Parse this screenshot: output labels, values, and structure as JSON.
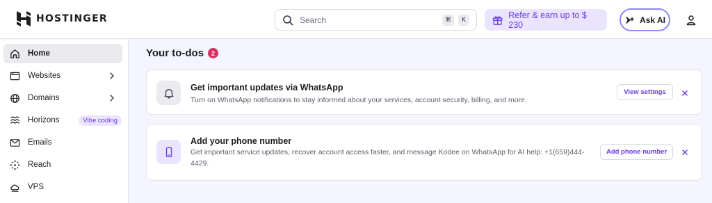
{
  "header": {
    "brand": "HOSTINGER",
    "search": {
      "placeholder": "Search",
      "shortcut_keys": [
        "⌘",
        "K"
      ]
    },
    "refer_label": "Refer & earn up to $ 230",
    "ask_ai_label": "Ask AI",
    "user_icon": "user-icon"
  },
  "sidebar": {
    "items": [
      {
        "label": "Home",
        "icon": "home-icon",
        "active": true
      },
      {
        "label": "Websites",
        "icon": "browser-window-icon",
        "chevron": true
      },
      {
        "label": "Domains",
        "icon": "globe-icon",
        "chevron": true
      },
      {
        "label": "Horizons",
        "icon": "horizons-icon",
        "badge": "Vibe coding"
      },
      {
        "label": "Emails",
        "icon": "envelope-icon"
      },
      {
        "label": "Reach",
        "icon": "sparkle-dots-icon"
      },
      {
        "label": "VPS",
        "icon": "server-cloud-icon"
      }
    ]
  },
  "todos": {
    "title": "Your to-dos",
    "count": "2",
    "items": [
      {
        "title": "Get important updates via WhatsApp",
        "description": "Turn on WhatsApp notifications to stay informed about your services, account security, billing, and more.",
        "button_label": "View settings",
        "icon": "bell-icon"
      },
      {
        "title": "Add your phone number",
        "description": "Get important service updates, recover account access faster, and message Kodee on WhatsApp for AI help: +1(659)444-4429.",
        "button_label": "Add phone number",
        "icon": "phone-icon"
      }
    ]
  },
  "colors": {
    "accent": "#673de6",
    "accent_light": "#ebe4ff",
    "badge_red": "#d63163",
    "background": "#f4f5ff"
  }
}
